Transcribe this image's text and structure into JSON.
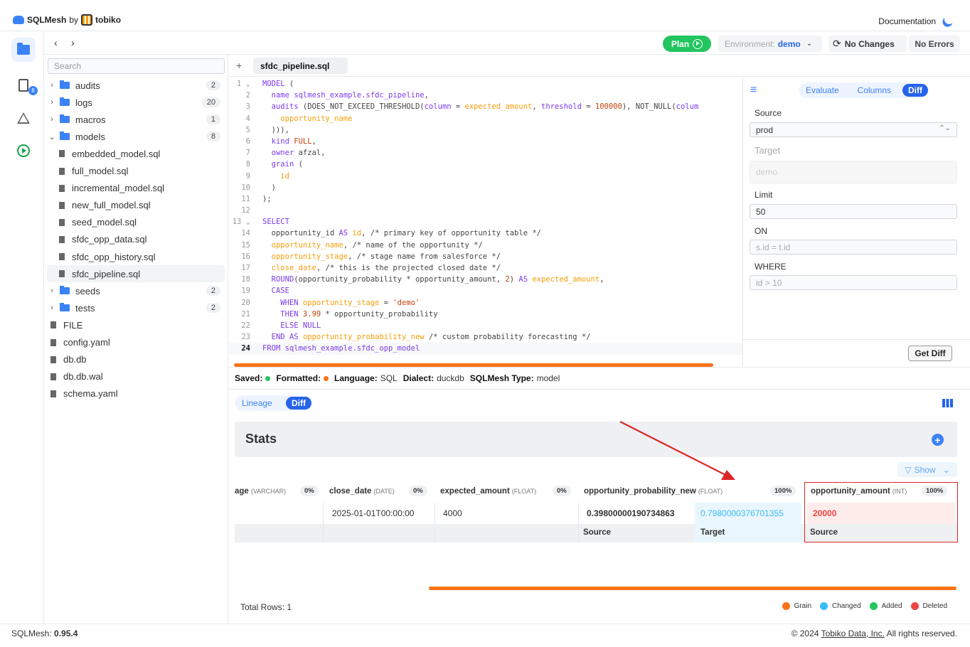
{
  "brand": {
    "product": "SQLMesh",
    "by": "by",
    "company": "tobiko"
  },
  "header": {
    "documentation": "Documentation"
  },
  "toolbar": {
    "plan": "Plan",
    "environment_label": "Environment:",
    "environment_value": "demo",
    "no_changes": "No Changes",
    "no_errors": "No Errors",
    "nav_back": "‹",
    "nav_forward": "›"
  },
  "rail": {
    "badge": "8"
  },
  "sidebar": {
    "search_placeholder": "Search",
    "tree": [
      {
        "label": "audits",
        "type": "folder",
        "count": "2",
        "chev": "›"
      },
      {
        "label": "logs",
        "type": "folder",
        "count": "20",
        "chev": "›"
      },
      {
        "label": "macros",
        "type": "folder",
        "count": "1",
        "chev": "›"
      },
      {
        "label": "models",
        "type": "folder",
        "count": "8",
        "chev": "⌄"
      },
      {
        "label": "embedded_model.sql",
        "type": "file"
      },
      {
        "label": "full_model.sql",
        "type": "file"
      },
      {
        "label": "incremental_model.sql",
        "type": "file"
      },
      {
        "label": "new_full_model.sql",
        "type": "file"
      },
      {
        "label": "seed_model.sql",
        "type": "file"
      },
      {
        "label": "sfdc_opp_data.sql",
        "type": "file"
      },
      {
        "label": "sfdc_opp_history.sql",
        "type": "file"
      },
      {
        "label": "sfdc_pipeline.sql",
        "type": "file",
        "selected": true
      },
      {
        "label": "seeds",
        "type": "folder",
        "count": "2",
        "chev": "›"
      },
      {
        "label": "tests",
        "type": "folder",
        "count": "2",
        "chev": "›"
      },
      {
        "label": "FILE",
        "type": "file"
      },
      {
        "label": "config.yaml",
        "type": "file"
      },
      {
        "label": "db.db",
        "type": "file"
      },
      {
        "label": "db.db.wal",
        "type": "file"
      },
      {
        "label": "schema.yaml",
        "type": "file"
      }
    ]
  },
  "editor": {
    "tab_plus": "+",
    "tab": "sfdc_pipeline.sql",
    "current_line": "24",
    "lines": [
      "<span class='kw'>MODEL</span> (",
      "  <span class='kw'>name</span> <span class='nm'>sqlmesh_example.sfdc_pipeline</span>,",
      "  <span class='kw'>audits</span> (DOES_NOT_EXCEED_THRESHOLD(<span class='kw'>column</span> = <span class='id'>expected_amount</span>, <span class='kw'>threshold</span> = <span class='st'>100000</span>), NOT_NULL(<span class='kw'>colum</span>",
      "    <span class='id'>opportunity_name</span>",
      "  ))),",
      "  <span class='kw'>kind</span> <span class='st'>FULL</span>,",
      "  <span class='kw'>owner</span> afzal,",
      "  <span class='kw'>grain</span> (",
      "    <span class='id'>id</span>",
      "  )",
      ");",
      "",
      "<span class='kw'>SELECT</span>",
      "  opportunity_id <span class='kw'>AS</span> <span class='id'>id</span>, <span class='cm'>/* primary key of opportunity table */</span>",
      "  <span class='id'>opportunity_name</span>, <span class='cm'>/* name of the opportunity */</span>",
      "  <span class='id'>opportunity_stage</span>, <span class='cm'>/* stage name from salesforce */</span>",
      "  <span class='id'>close_date</span>, <span class='cm'>/* this is the projected closed date */</span>",
      "  <span class='kw'>ROUND</span>(opportunity_probability * opportunity_amount, <span class='st'>2</span>) <span class='kw'>AS</span> <span class='id'>expected_amount</span>,",
      "  <span class='kw'>CASE</span>",
      "    <span class='kw'>WHEN</span> <span class='id'>opportunity_stage</span> = <span class='st'>'demo'</span>",
      "    <span class='kw'>THEN</span> <span class='st'>3.99</span> * opportunity_probability",
      "    <span class='kw'>ELSE</span> <span class='kw'>NULL</span>",
      "  <span class='kw'>END</span> <span class='kw'>AS</span> <span class='id'>opportunity_probability_new</span> <span class='cm'>/* custom probability forecasting */</span>",
      "<span class='kw'>FROM</span> <span class='nm'>sqlmesh_example.sfdc_opp_model</span>"
    ]
  },
  "diff_panel": {
    "tabs": [
      "Evaluate",
      "Columns",
      "Diff"
    ],
    "source_label": "Source",
    "source_value": "prod",
    "target_label": "Target",
    "target_placeholder": "demo",
    "limit_label": "Limit",
    "limit_value": "50",
    "on_label": "ON",
    "on_placeholder": "s.id = t.id",
    "where_label": "WHERE",
    "where_placeholder": "id > 10",
    "get_diff": "Get Diff"
  },
  "status": {
    "saved": "Saved:",
    "formatted": "Formatted:",
    "language_label": "Language:",
    "language": "SQL",
    "dialect_label": "Dialect:",
    "dialect": "duckdb",
    "type_label": "SQLMesh Type:",
    "type": "model",
    "saved_color": "#22c55e",
    "formatted_color": "#f97316"
  },
  "bottom": {
    "tabs": [
      "Lineage",
      "Diff"
    ],
    "stats_title": "Stats",
    "show": "Show",
    "columns": [
      {
        "name": "age",
        "type": "(VARCHAR)",
        "pct": "0%"
      },
      {
        "name": "close_date",
        "type": "(DATE)",
        "pct": "0%"
      },
      {
        "name": "expected_amount",
        "type": "(FLOAT)",
        "pct": "0%"
      },
      {
        "name": "opportunity_probability_new",
        "type": "(FLOAT)",
        "pct": "100%"
      },
      {
        "name": "opportunity_amount",
        "type": "(INT)",
        "pct": "100%"
      }
    ],
    "row": {
      "close_date": "2025-01-01T00:00:00",
      "expected_amount": "4000",
      "prob_source": "0.39800000190734863",
      "prob_target": "0.7980000376701355",
      "amount_source": "20000"
    },
    "sub": {
      "source": "Source",
      "target": "Target",
      "source2": "Source"
    },
    "total_rows": "Total Rows: 1",
    "legend": [
      {
        "label": "Grain",
        "color": "#f97316"
      },
      {
        "label": "Changed",
        "color": "#38bdf8"
      },
      {
        "label": "Added",
        "color": "#22c55e"
      },
      {
        "label": "Deleted",
        "color": "#ef4444"
      }
    ]
  },
  "footer": {
    "version_label": "SQLMesh:",
    "version": "0.95.4",
    "copyright": "© 2024",
    "company_link": "Tobiko Data, Inc.",
    "rights": "All rights reserved."
  }
}
